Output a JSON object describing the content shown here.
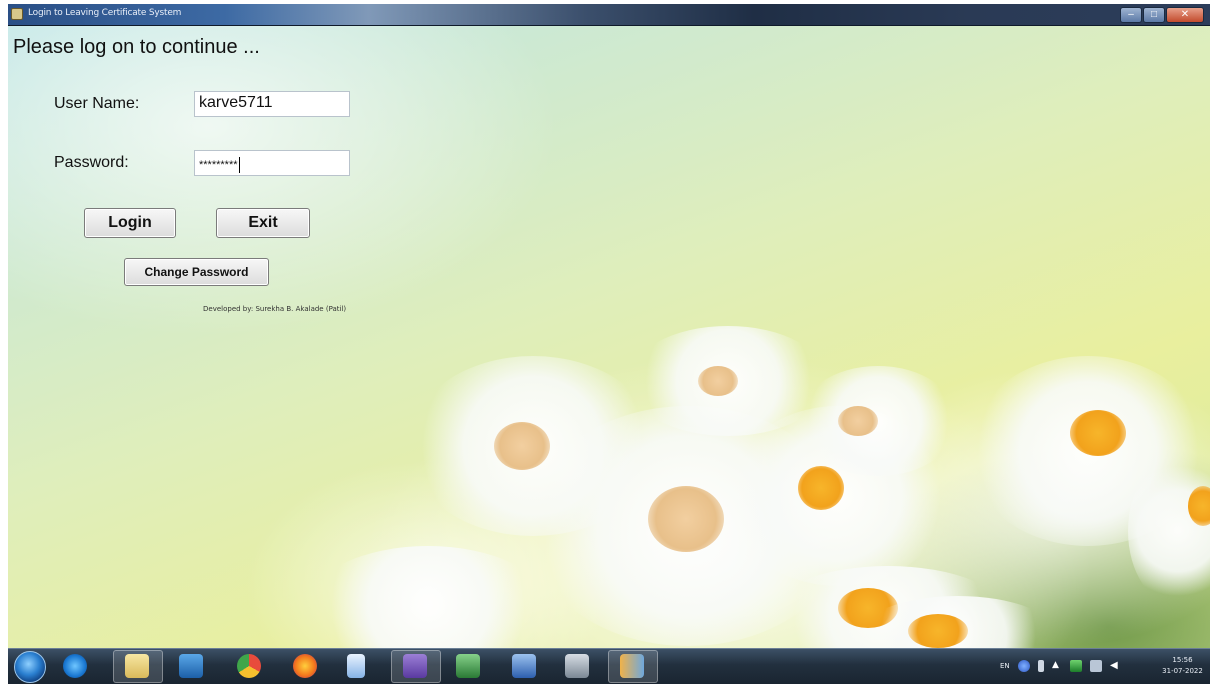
{
  "window": {
    "title": "Login to Leaving Certificate System",
    "controls": [
      "minimize-icon",
      "maximize-icon",
      "close-icon"
    ]
  },
  "form": {
    "heading": "Please log on to continue ...",
    "username_label": "User Name:",
    "username_value": "karve5711",
    "password_label": "Password:",
    "password_value": "*********",
    "login_label": "Login",
    "exit_label": "Exit",
    "change_password_label": "Change Password",
    "developer_credit": "Developed by: Surekha B. Akalade (Patil)"
  },
  "taskbar": {
    "pinned": [
      "start-orb-icon",
      "internet-explorer-icon",
      "file-explorer-icon",
      "media-player-icon",
      "chrome-icon",
      "firefox-icon",
      "notepad-icon",
      "visual-studio-icon",
      "excel-icon",
      "word-icon",
      "network-computer-icon",
      "app-window-icon"
    ],
    "tray": {
      "language": "EN",
      "time": "15:56",
      "date": "31-07-2022"
    }
  },
  "colors": {
    "titlebar": "#3d6aa4",
    "taskbar": "#22303e",
    "button_face": "#e6e6e6",
    "background_tint": "#dfeebb"
  }
}
